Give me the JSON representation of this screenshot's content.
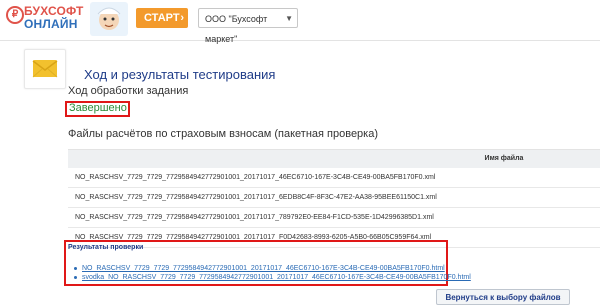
{
  "header": {
    "logo_line1": "БУХСОФТ",
    "logo_line2": "ОНЛАЙН",
    "start_label": "СТАРТ",
    "company_select_value": "ООО \"Бухсофт маркет\""
  },
  "page": {
    "title": "Ход и результаты тестирования",
    "processing_label": "Ход обработки задания",
    "status": "Завершено",
    "files_section_title": "Файлы расчётов по страховым взносам (пакетная проверка)"
  },
  "files_table": {
    "column_header": "Имя файла",
    "rows": [
      "NO_RASCHSV_7729_7729_7729584942772901001_20171017_46EC6710-167E-3C4B-CE49-00BA5FB170F0.xml",
      "NO_RASCHSV_7729_7729_7729584942772901001_20171017_6EDB8C4F-8F3C-47E2-AA38-95BEE61150C1.xml",
      "NO_RASCHSV_7729_7729_7729584942772901001_20171017_789792E0-EE84-F1CD-535E-1D42996385D1.xml",
      "NO_RASCHSV_7729_7729_7729584942772901001_20171017_F0D42683-8993-6205-A5B0-66B05C959F64.xml"
    ]
  },
  "results": {
    "title": "Результаты проверки",
    "links": [
      "NO_RASCHSV_7729_7729_7729584942772901001_20171017_46EC6710-167E-3C4B-CE49-00BA5FB170F0.html",
      "svodka_NO_RASCHSV_7729_7729_7729584942772901001_20171017_46EC6710-167E-3C4B-CE49-00BA5FB170F0.html"
    ]
  },
  "actions": {
    "back_label": "Вернуться к выбору файлов"
  },
  "colors": {
    "accent_orange": "#f39a2c",
    "title_blue": "#1f3c88",
    "status_green": "#2e8b3a",
    "highlight_red": "#e01818",
    "link_blue": "#2a6bb5"
  },
  "icons": [
    "logo-mark-icon",
    "mascot-icon",
    "chevron-right-icon",
    "dropdown-arrow-icon",
    "envelope-icon"
  ]
}
